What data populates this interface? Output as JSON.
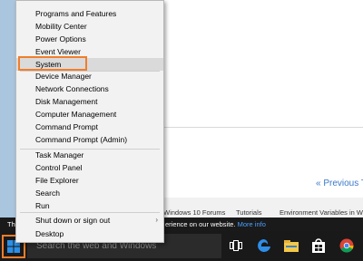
{
  "background": {
    "previous_link": "« Previous T",
    "tabs": [
      "Windows 10 Forums",
      "Tutorials",
      "Environment Variables in W"
    ],
    "cookie_left": "Thi",
    "cookie_text": "erience on our website.",
    "cookie_link": "More info"
  },
  "menu": {
    "items": [
      {
        "label": "Programs and Features"
      },
      {
        "label": "Mobility Center"
      },
      {
        "label": "Power Options"
      },
      {
        "label": "Event Viewer"
      },
      {
        "label": "System",
        "selected": true
      },
      {
        "label": "Device Manager"
      },
      {
        "label": "Network Connections"
      },
      {
        "label": "Disk Management"
      },
      {
        "label": "Computer Management"
      },
      {
        "label": "Command Prompt"
      },
      {
        "label": "Command Prompt (Admin)"
      },
      {
        "label": "Task Manager"
      },
      {
        "label": "Control Panel"
      },
      {
        "label": "File Explorer"
      },
      {
        "label": "Search"
      },
      {
        "label": "Run"
      },
      {
        "label": "Shut down or sign out"
      },
      {
        "label": "Desktop"
      }
    ],
    "submenu_arrow": "›"
  },
  "taskbar": {
    "search_placeholder": "Search the web and Windows"
  },
  "colors": {
    "highlight": "#f07e2b",
    "taskbar": "#191919",
    "accent_blue": "#3a78c8"
  }
}
